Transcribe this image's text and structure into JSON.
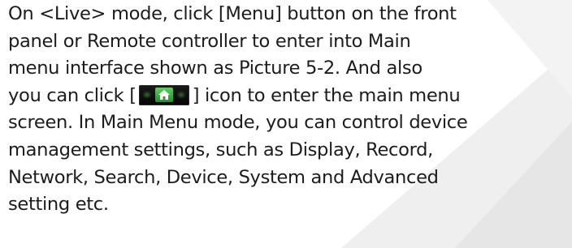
{
  "paragraph": {
    "line1": "On <Live> mode, click [Menu] button on the front",
    "line2": "panel or Remote controller to enter into Main",
    "line3": "menu interface shown as Picture 5-2. And also",
    "line4_before": "you can click [",
    "line4_after": "] icon to enter the main menu",
    "line5": "screen. In Main Menu mode, you can control device",
    "line6": "management settings, such as Display, Record,",
    "line7": "Network, Search, Device, System and Advanced",
    "line8": "setting etc."
  },
  "inline_icon": {
    "name": "home-icon",
    "accent": "#2fa83a",
    "background": "#0a0a0a"
  },
  "colors": {
    "text": "#1c1c1c",
    "background": "#ffffff",
    "shape_light": "#f4f4f4",
    "shape_mid": "#ebebeb"
  }
}
